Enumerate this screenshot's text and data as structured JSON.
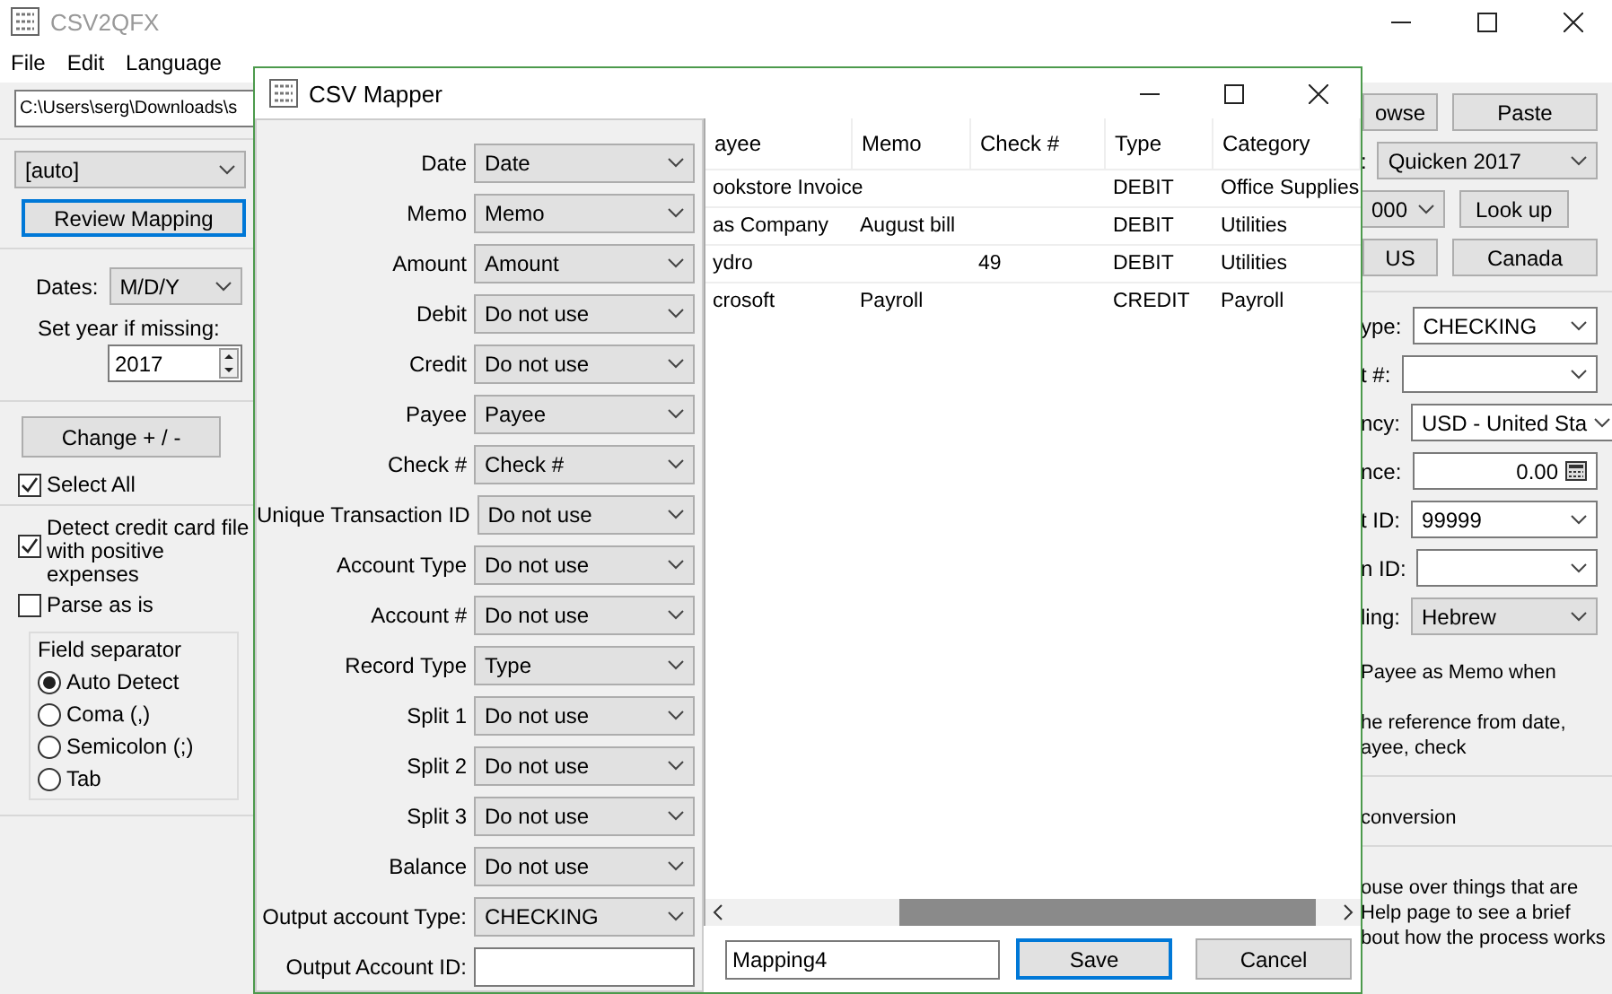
{
  "main_window": {
    "title": "CSV2QFX",
    "menu": [
      "File",
      "Edit",
      "Language"
    ],
    "path_field": {
      "value": "C:\\Users\\serg\\Downloads\\s"
    },
    "format_dropdown": {
      "value": "[auto]"
    },
    "review_button": "Review Mapping",
    "dates": {
      "label": "Dates:",
      "value": "M/D/Y"
    },
    "year": {
      "label": "Set year if missing:",
      "value": "2017"
    },
    "change_button": "Change + / -",
    "select_all": {
      "label": "Select All",
      "checked": true
    },
    "options": [
      {
        "label": "Detect credit card file with positive expenses",
        "checked": true
      },
      {
        "label": "Parse as is",
        "checked": false
      }
    ],
    "field_separator": {
      "title": "Field separator",
      "options": [
        {
          "label": "Auto Detect",
          "selected": true
        },
        {
          "label": "Coma (,)",
          "selected": false
        },
        {
          "label": "Semicolon (;)",
          "selected": false
        },
        {
          "label": "Tab",
          "selected": false
        }
      ]
    },
    "right_panel": [
      {
        "kind": "buttons",
        "buttons": [
          "owse",
          "Paste"
        ]
      },
      {
        "kind": "select",
        "label": ":",
        "value": "Quicken 2017"
      },
      {
        "kind": "select",
        "value": "000",
        "button": "Look up"
      },
      {
        "kind": "buttons",
        "buttons": [
          "US",
          "Canada"
        ]
      },
      {
        "kind": "divider"
      },
      {
        "kind": "combo",
        "label": "ype:",
        "value": "CHECKING"
      },
      {
        "kind": "combo",
        "label": "t #:"
      },
      {
        "kind": "combo",
        "label": "ncy:",
        "value": "USD - United Sta"
      },
      {
        "kind": "number",
        "label": "nce:",
        "value": "0.00"
      },
      {
        "kind": "combo",
        "label": "t ID:",
        "value": "99999"
      },
      {
        "kind": "combo",
        "label": "n ID:"
      },
      {
        "kind": "select",
        "label": "ling:",
        "value": "Hebrew"
      },
      {
        "kind": "text",
        "lines": [
          "Payee as Memo when"
        ]
      },
      {
        "kind": "text",
        "lines": [
          "he reference from date,",
          "ayee, check"
        ]
      },
      {
        "kind": "divider"
      },
      {
        "kind": "text",
        "lines": [
          "conversion"
        ]
      },
      {
        "kind": "divider"
      },
      {
        "kind": "text",
        "lines": [
          "ouse over things that are",
          "Help page to see a brief",
          "bout how the process works"
        ]
      }
    ]
  },
  "mapper": {
    "title": "CSV Mapper",
    "fields": [
      {
        "kind": "select",
        "label": "Date",
        "value": "Date"
      },
      {
        "kind": "select",
        "label": "Memo",
        "value": "Memo"
      },
      {
        "kind": "select",
        "label": "Amount",
        "value": "Amount"
      },
      {
        "kind": "select",
        "label": "Debit",
        "value": "Do not use"
      },
      {
        "kind": "select",
        "label": "Credit",
        "value": "Do not use"
      },
      {
        "kind": "select",
        "label": "Payee",
        "value": "Payee"
      },
      {
        "kind": "select",
        "label": "Check #",
        "value": "Check #"
      },
      {
        "kind": "select",
        "label": "Unique Transaction ID",
        "value": "Do not use"
      },
      {
        "kind": "select",
        "label": "Account Type",
        "value": "Do not use"
      },
      {
        "kind": "select",
        "label": "Account #",
        "value": "Do not use"
      },
      {
        "kind": "select",
        "label": "Record Type",
        "value": "Type"
      },
      {
        "kind": "select",
        "label": "Split 1",
        "value": "Do not use"
      },
      {
        "kind": "select",
        "label": "Split 2",
        "value": "Do not use"
      },
      {
        "kind": "select",
        "label": "Split 3",
        "value": "Do not use"
      },
      {
        "kind": "select",
        "label": "Balance",
        "value": "Do not use"
      },
      {
        "kind": "select",
        "label": "Output account Type:",
        "value": "CHECKING"
      },
      {
        "kind": "input",
        "label": "Output Account ID:"
      }
    ],
    "table": {
      "columns": [
        "ayee",
        "Memo",
        "Check #",
        "Type",
        "Category"
      ],
      "rows": [
        [
          "ookstore Invoice",
          null,
          null,
          "DEBIT",
          "Office Supplies"
        ],
        [
          "as Company",
          "August bill",
          null,
          "DEBIT",
          "Utilities"
        ],
        [
          "ydro",
          null,
          "49",
          "DEBIT",
          "Utilities"
        ],
        [
          "crosoft",
          "Payroll",
          null,
          "CREDIT",
          "Payroll"
        ]
      ]
    },
    "mapping_name": {
      "value": "Mapping4"
    },
    "buttons": [
      {
        "label": "Save",
        "default": true
      },
      {
        "label": "Cancel",
        "default": false
      }
    ]
  }
}
